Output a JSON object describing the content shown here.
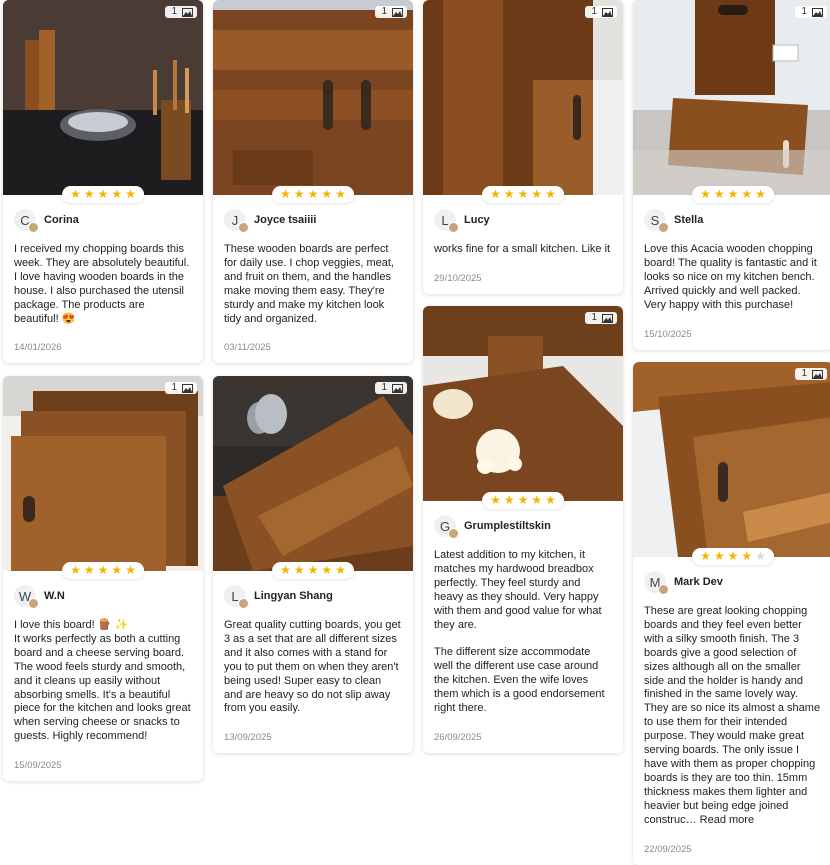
{
  "gallery": {
    "photo_count_label": "1",
    "reviews": [
      {
        "id": "r1",
        "author": "Corina",
        "initial": "C",
        "rating": 5,
        "date": "14/01/2026",
        "text": "I received my chopping boards this week. They are absolutely beautiful. I love having wooden boards in the house. I also purchased the utensil package. The products are beautiful! 😍"
      },
      {
        "id": "r2",
        "author": "Joyce tsaiiii",
        "initial": "J",
        "rating": 5,
        "date": "03/11/2025",
        "text": "These wooden boards are perfect for daily use. I chop veggies, meat, and fruit on them, and the handles make moving them easy. They're sturdy and make my kitchen look tidy and organized."
      },
      {
        "id": "r3",
        "author": "Lucy",
        "initial": "L",
        "rating": 5,
        "date": "29/10/2025",
        "text": "works fine for a small kitchen. Like it"
      },
      {
        "id": "r4",
        "author": "Stella",
        "initial": "S",
        "rating": 5,
        "date": "15/10/2025",
        "text": "Love this Acacia wooden chopping board! The quality is fantastic and it looks so nice on my kitchen bench. Arrived quickly and well packed. Very happy with this purchase!"
      },
      {
        "id": "r5",
        "author": "W.N",
        "initial": "W",
        "rating": 5,
        "date": "15/09/2025",
        "text": "I love this board! 🪵 ✨\nIt works perfectly as both a cutting board and a cheese serving board. The wood feels sturdy and smooth, and it cleans up easily without absorbing smells. It's a beautiful piece for the kitchen and looks great when serving cheese or snacks to guests. Highly recommend!"
      },
      {
        "id": "r6",
        "author": "Lingyan Shang",
        "initial": "L",
        "rating": 5,
        "date": "13/09/2025",
        "text": "Great quality cutting boards, you get 3 as a set that are all different sizes and it also comes with a stand for you to put them on when they aren't being used! Super easy to clean and are heavy so do not slip away from you easily."
      },
      {
        "id": "r7",
        "author": "Grumplestiltskin",
        "initial": "G",
        "rating": 5,
        "date": "26/09/2025",
        "text": "Latest addition to my kitchen, it matches my hardwood breadbox perfectly. They feel sturdy and heavy as they should. Very happy with them and good value for what they are.\n\nThe different size accommodate well the different use case around the kitchen. Even the wife loves them which is a good endorsement right there."
      },
      {
        "id": "r8",
        "author": "Mark Dev",
        "initial": "M",
        "rating": 4,
        "date": "22/09/2025",
        "text": "These are great looking chopping boards and they feel even better with a silky smooth finish. The 3 boards give a good selection of sizes although all on the smaller side and the holder is handy and finished in the same lovely way. They are so nice its almost a shame to use them for their intended purpose. They would make great serving boards. The only issue I have with them as proper chopping boards is they are too thin. 15mm thickness makes them lighter and heavier but being edge joined construc…",
        "read_more": "Read more"
      }
    ]
  },
  "colors": {
    "star": "#f5b400",
    "star_off": "#d9d9d9",
    "date": "#8a8a8a",
    "wood": "#8a4f1e"
  }
}
